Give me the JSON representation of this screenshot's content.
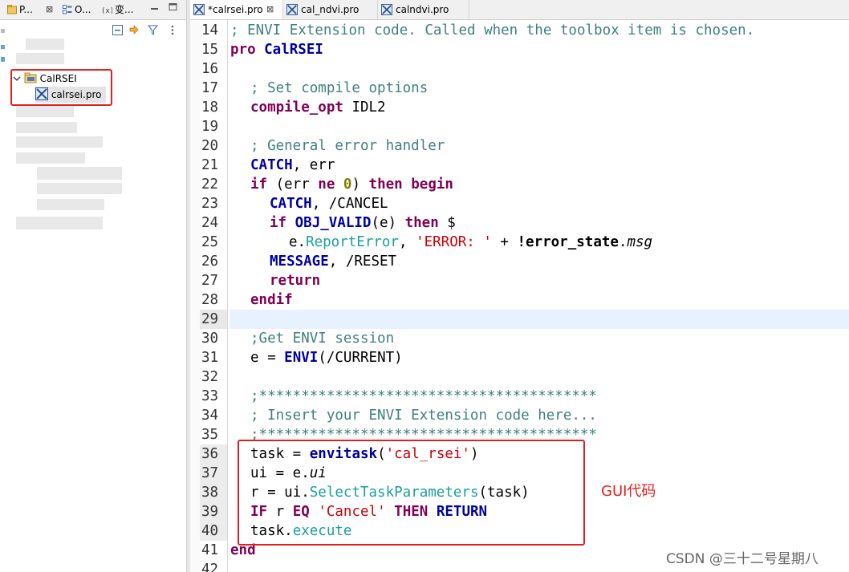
{
  "left_panel": {
    "tabs": [
      {
        "label": "P...",
        "icon": "package-explorer-icon"
      },
      {
        "label": "O...",
        "icon": "outline-icon"
      },
      {
        "label": "变...",
        "icon": "variables-icon"
      }
    ],
    "close_glyph": "⊠",
    "tree": {
      "project": "CalRSEI",
      "file": "calrsei.pro"
    }
  },
  "editor": {
    "tabs": [
      {
        "label": "*calrsei.pro",
        "active": true,
        "close": "⊠"
      },
      {
        "label": "cal_ndvi.pro",
        "active": false
      },
      {
        "label": "calndvi.pro",
        "active": false
      }
    ],
    "highlighted_line": "29",
    "lines": [
      {
        "n": "14",
        "text": "; ENVI Extension code. Called when the toolbox item is chosen."
      },
      {
        "n": "15",
        "t1": "pro",
        "t2": " CalRSEI"
      },
      {
        "n": "16",
        "text": ""
      },
      {
        "n": "17",
        "text": "; Set compile options"
      },
      {
        "n": "18",
        "t1": "compile_opt",
        "t2": " IDL2"
      },
      {
        "n": "19",
        "text": ""
      },
      {
        "n": "20",
        "text": "; General error handler"
      },
      {
        "n": "21",
        "t1": "CATCH",
        "t2": ", err"
      },
      {
        "n": "22",
        "t1": "if",
        "t2": " (err ",
        "t3": "ne",
        "t4": " ",
        "t5": "0",
        "t6": ") ",
        "t7": "then",
        "t8": " ",
        "t9": "begin"
      },
      {
        "n": "23",
        "t1": "CATCH",
        "t2": ", /CANCEL"
      },
      {
        "n": "24",
        "t1": "if",
        "t2": " ",
        "t3": "OBJ_VALID",
        "t4": "(e) ",
        "t5": "then",
        "t6": " $"
      },
      {
        "n": "25",
        "t1": "e.",
        "t2": "ReportError",
        "t3": ", ",
        "t4": "'ERROR: '",
        "t5": " + ",
        "t6": "!error_state",
        "t7": ".",
        "t8": "msg"
      },
      {
        "n": "26",
        "t1": "MESSAGE",
        "t2": ", /RESET"
      },
      {
        "n": "27",
        "t1": "return"
      },
      {
        "n": "28",
        "t1": "endif"
      },
      {
        "n": "29",
        "text": ""
      },
      {
        "n": "30",
        "text": ";Get ENVI session"
      },
      {
        "n": "31",
        "t1": "e = ",
        "t2": "ENVI",
        "t3": "(/CURRENT)"
      },
      {
        "n": "32",
        "text": ""
      },
      {
        "n": "33",
        "text": ";****************************************"
      },
      {
        "n": "34",
        "text": "; Insert your ENVI Extension code here..."
      },
      {
        "n": "35",
        "text": ";****************************************"
      },
      {
        "n": "36",
        "t1": "task = ",
        "t2": "envitask",
        "t3": "(",
        "t4": "'cal_rsei'",
        "t5": ")"
      },
      {
        "n": "37",
        "t1": "ui = e.",
        "t2": "ui"
      },
      {
        "n": "38",
        "t1": "r = ui.",
        "t2": "SelectTaskParameters",
        "t3": "(task)"
      },
      {
        "n": "39",
        "t1": "IF",
        "t2": " r ",
        "t3": "EQ",
        "t4": " ",
        "t5": "'Cancel'",
        "t6": " ",
        "t7": "THEN",
        "t8": " ",
        "t9": "RETURN"
      },
      {
        "n": "40",
        "t1": "task.",
        "t2": "execute"
      },
      {
        "n": "41",
        "t1": "end"
      },
      {
        "n": "42",
        "text": ""
      }
    ]
  },
  "annotation": "GUI代码",
  "watermark": "CSDN @三十二号星期八",
  "colors": {
    "comment": "#3f7f7f",
    "keyword": "#7f0055",
    "builtin": "#00009f",
    "string": "#c8000a",
    "method": "#1a9ea0",
    "highlight_box": "#e02020",
    "current_line": "#e8f2fe"
  }
}
